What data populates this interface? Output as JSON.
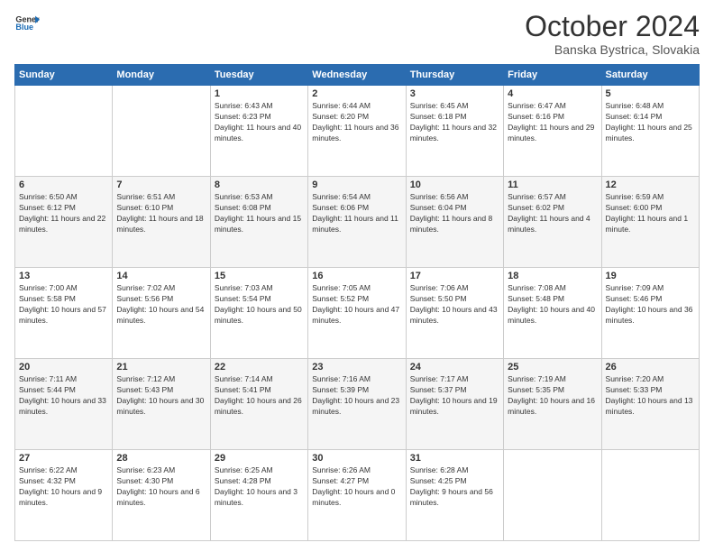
{
  "header": {
    "logo_line1": "General",
    "logo_line2": "Blue",
    "month": "October 2024",
    "location": "Banska Bystrica, Slovakia"
  },
  "weekdays": [
    "Sunday",
    "Monday",
    "Tuesday",
    "Wednesday",
    "Thursday",
    "Friday",
    "Saturday"
  ],
  "weeks": [
    [
      null,
      null,
      {
        "day": 1,
        "sunrise": "6:43 AM",
        "sunset": "6:23 PM",
        "daylight": "11 hours and 40 minutes."
      },
      {
        "day": 2,
        "sunrise": "6:44 AM",
        "sunset": "6:20 PM",
        "daylight": "11 hours and 36 minutes."
      },
      {
        "day": 3,
        "sunrise": "6:45 AM",
        "sunset": "6:18 PM",
        "daylight": "11 hours and 32 minutes."
      },
      {
        "day": 4,
        "sunrise": "6:47 AM",
        "sunset": "6:16 PM",
        "daylight": "11 hours and 29 minutes."
      },
      {
        "day": 5,
        "sunrise": "6:48 AM",
        "sunset": "6:14 PM",
        "daylight": "11 hours and 25 minutes."
      }
    ],
    [
      {
        "day": 6,
        "sunrise": "6:50 AM",
        "sunset": "6:12 PM",
        "daylight": "11 hours and 22 minutes."
      },
      {
        "day": 7,
        "sunrise": "6:51 AM",
        "sunset": "6:10 PM",
        "daylight": "11 hours and 18 minutes."
      },
      {
        "day": 8,
        "sunrise": "6:53 AM",
        "sunset": "6:08 PM",
        "daylight": "11 hours and 15 minutes."
      },
      {
        "day": 9,
        "sunrise": "6:54 AM",
        "sunset": "6:06 PM",
        "daylight": "11 hours and 11 minutes."
      },
      {
        "day": 10,
        "sunrise": "6:56 AM",
        "sunset": "6:04 PM",
        "daylight": "11 hours and 8 minutes."
      },
      {
        "day": 11,
        "sunrise": "6:57 AM",
        "sunset": "6:02 PM",
        "daylight": "11 hours and 4 minutes."
      },
      {
        "day": 12,
        "sunrise": "6:59 AM",
        "sunset": "6:00 PM",
        "daylight": "11 hours and 1 minute."
      }
    ],
    [
      {
        "day": 13,
        "sunrise": "7:00 AM",
        "sunset": "5:58 PM",
        "daylight": "10 hours and 57 minutes."
      },
      {
        "day": 14,
        "sunrise": "7:02 AM",
        "sunset": "5:56 PM",
        "daylight": "10 hours and 54 minutes."
      },
      {
        "day": 15,
        "sunrise": "7:03 AM",
        "sunset": "5:54 PM",
        "daylight": "10 hours and 50 minutes."
      },
      {
        "day": 16,
        "sunrise": "7:05 AM",
        "sunset": "5:52 PM",
        "daylight": "10 hours and 47 minutes."
      },
      {
        "day": 17,
        "sunrise": "7:06 AM",
        "sunset": "5:50 PM",
        "daylight": "10 hours and 43 minutes."
      },
      {
        "day": 18,
        "sunrise": "7:08 AM",
        "sunset": "5:48 PM",
        "daylight": "10 hours and 40 minutes."
      },
      {
        "day": 19,
        "sunrise": "7:09 AM",
        "sunset": "5:46 PM",
        "daylight": "10 hours and 36 minutes."
      }
    ],
    [
      {
        "day": 20,
        "sunrise": "7:11 AM",
        "sunset": "5:44 PM",
        "daylight": "10 hours and 33 minutes."
      },
      {
        "day": 21,
        "sunrise": "7:12 AM",
        "sunset": "5:43 PM",
        "daylight": "10 hours and 30 minutes."
      },
      {
        "day": 22,
        "sunrise": "7:14 AM",
        "sunset": "5:41 PM",
        "daylight": "10 hours and 26 minutes."
      },
      {
        "day": 23,
        "sunrise": "7:16 AM",
        "sunset": "5:39 PM",
        "daylight": "10 hours and 23 minutes."
      },
      {
        "day": 24,
        "sunrise": "7:17 AM",
        "sunset": "5:37 PM",
        "daylight": "10 hours and 19 minutes."
      },
      {
        "day": 25,
        "sunrise": "7:19 AM",
        "sunset": "5:35 PM",
        "daylight": "10 hours and 16 minutes."
      },
      {
        "day": 26,
        "sunrise": "7:20 AM",
        "sunset": "5:33 PM",
        "daylight": "10 hours and 13 minutes."
      }
    ],
    [
      {
        "day": 27,
        "sunrise": "6:22 AM",
        "sunset": "4:32 PM",
        "daylight": "10 hours and 9 minutes."
      },
      {
        "day": 28,
        "sunrise": "6:23 AM",
        "sunset": "4:30 PM",
        "daylight": "10 hours and 6 minutes."
      },
      {
        "day": 29,
        "sunrise": "6:25 AM",
        "sunset": "4:28 PM",
        "daylight": "10 hours and 3 minutes."
      },
      {
        "day": 30,
        "sunrise": "6:26 AM",
        "sunset": "4:27 PM",
        "daylight": "10 hours and 0 minutes."
      },
      {
        "day": 31,
        "sunrise": "6:28 AM",
        "sunset": "4:25 PM",
        "daylight": "9 hours and 56 minutes."
      },
      null,
      null
    ]
  ]
}
